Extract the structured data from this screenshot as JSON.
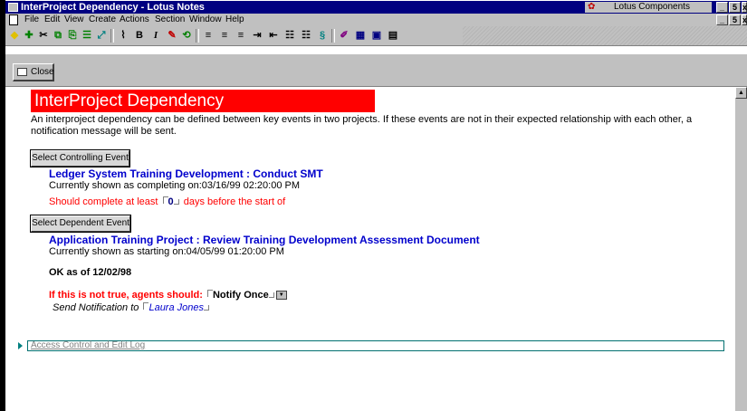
{
  "window": {
    "title": "InterProject Dependency - Lotus Notes",
    "components_label": "Lotus Components",
    "controls": [
      "_",
      "5",
      "x"
    ]
  },
  "menubar": {
    "items": [
      "File",
      "Edit",
      "View",
      "Create",
      "Actions",
      "Section",
      "Window",
      "Help"
    ],
    "doc_controls": [
      "_",
      "5",
      "x"
    ]
  },
  "toolbar": {
    "bold": "B",
    "italic": "I"
  },
  "actionbar": {
    "close_label": "Close"
  },
  "form": {
    "banner_title": "InterProject Dependency",
    "description": "An interproject dependency can be defined between key events in two projects.  If these events are not in their expected relationship with each other, a notification message will be sent.",
    "controlling": {
      "button_label": "Select Controlling Event",
      "event_title": "Ledger System Training Development : Conduct SMT",
      "status_text": "Currently shown as completing on:03/16/99 02:20:00 PM",
      "rule_prefix": "Should complete at least",
      "days_value": "0",
      "rule_suffix": "days before the start of"
    },
    "dependent": {
      "button_label": "Select Dependent Event",
      "event_title": "Application Training Project : Review Training Development Assessment Document",
      "status_text": "Currently shown as starting on:04/05/99 01:20:00 PM"
    },
    "ok_status": "OK as of 12/02/98",
    "agent_label": "If this is not true, agents should:",
    "agent_value": "Notify Once",
    "notify_label": "Send Notification to",
    "notify_value": "Laura Jones",
    "section_label": "Access Control and Edit Log"
  },
  "colors": {
    "banner": "#ff0000",
    "event_title": "#0000cc",
    "rule_text": "#ff0000",
    "titlebar": "#000080"
  }
}
